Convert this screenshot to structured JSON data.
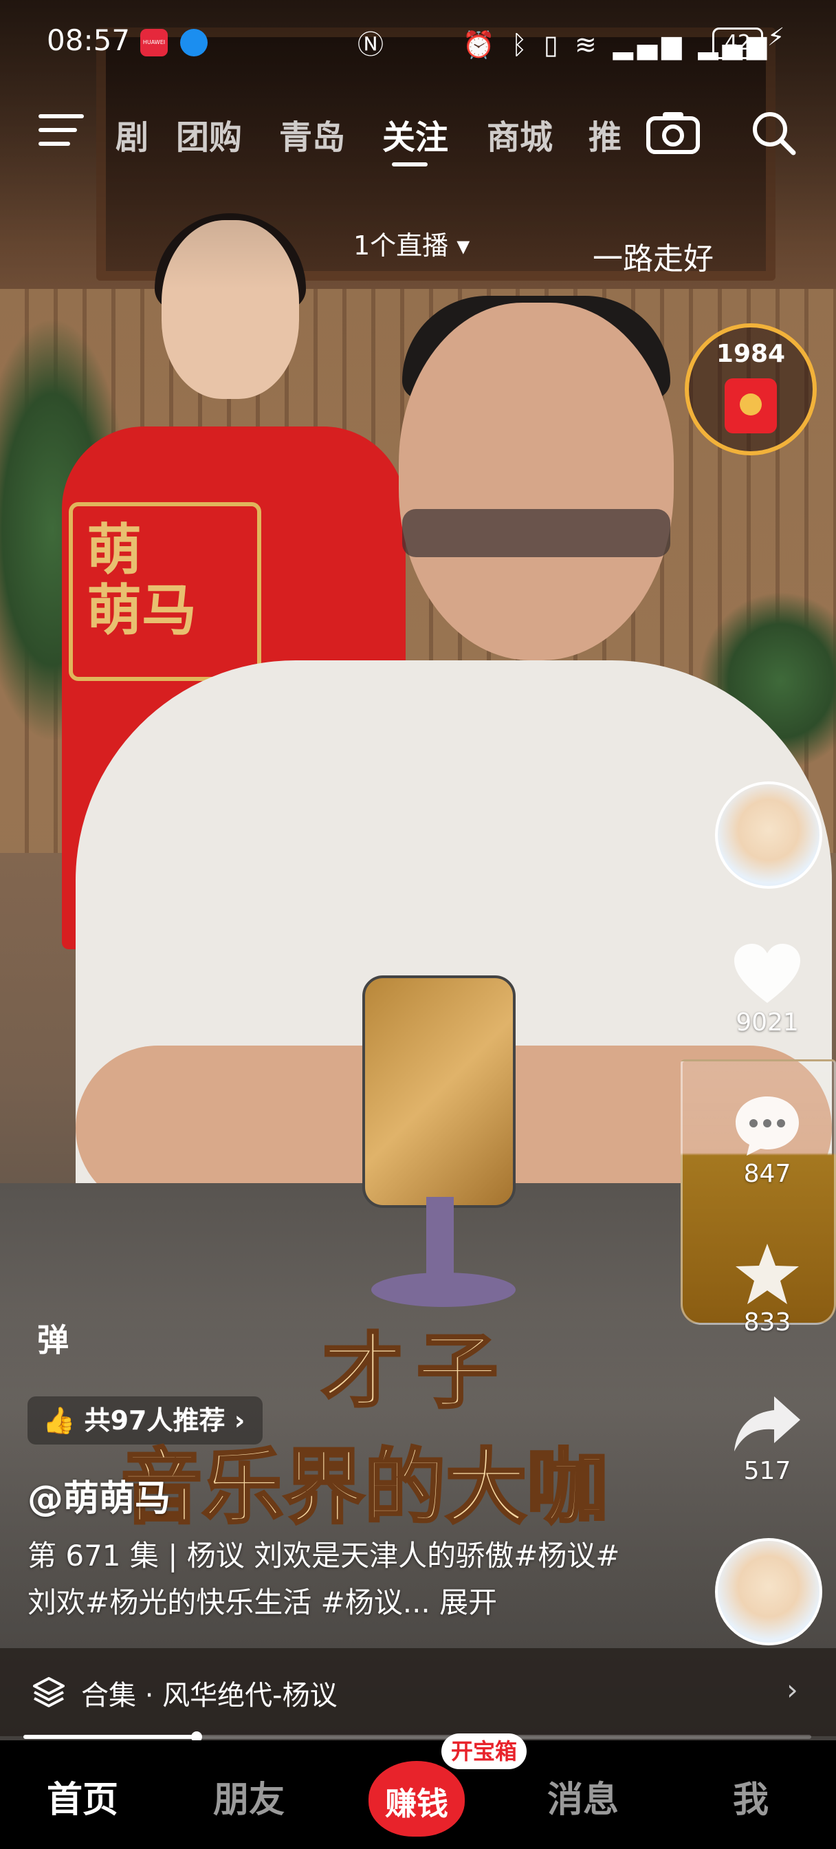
{
  "status_bar": {
    "time": "08:57",
    "battery": "42",
    "notification_apps": [
      "huawei-store-icon",
      "browser-icon"
    ],
    "status_icons": [
      "nfc-icon",
      "alarm-icon",
      "bluetooth-icon",
      "vibrate-icon",
      "wifi-icon",
      "signal-icon",
      "signal-icon",
      "battery-icon",
      "charging-icon"
    ]
  },
  "top_nav": {
    "tabs": [
      "剧",
      "团购",
      "青岛",
      "关注",
      "商城",
      "推"
    ],
    "active_tab": "关注",
    "live_indicator": "1个直播",
    "top_right_text": "一路走好"
  },
  "red_packet": {
    "count": "1984"
  },
  "side_actions": {
    "likes": "9021",
    "comments": "847",
    "favorites": "833",
    "shares": "517"
  },
  "danmu_label": "弹",
  "recommend": {
    "label": "共97人推荐",
    "chevron": "›"
  },
  "subtitles": {
    "line1": "才子",
    "line2": "音乐界的大咖"
  },
  "video_info": {
    "author": "@萌萌马",
    "description": "第 671 集 | 杨议 刘欢是天津人的骄傲#杨议#刘欢#杨光的快乐生活 #杨议...",
    "expand": "展开"
  },
  "collection": {
    "label": "合集 · 风华绝代-杨议"
  },
  "progress": {
    "fraction": 0.22
  },
  "bottom_nav": {
    "items": [
      "首页",
      "朋友",
      "赚钱",
      "消息",
      "我"
    ],
    "badge": "开宝箱",
    "active": "首页"
  },
  "colors": {
    "accent": "#e8232b",
    "gold": "#f2b23a",
    "subtitle": "#f6d7a2"
  }
}
